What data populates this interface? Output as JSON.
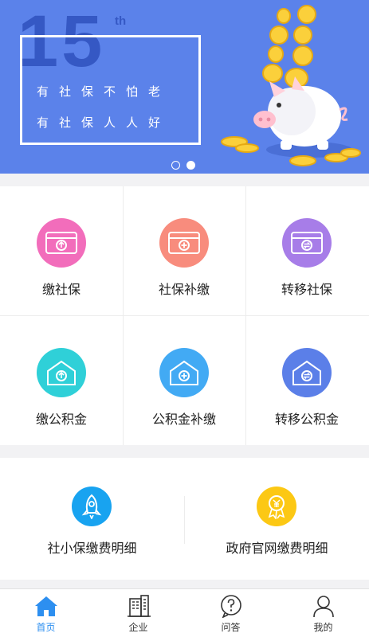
{
  "banner": {
    "big_number": "15",
    "superscript": "th",
    "slogan_line1": "有社保不怕老",
    "slogan_line2": "有社保人人好",
    "pager": {
      "count": 2,
      "active_index": 1
    }
  },
  "services": [
    {
      "label": "缴社保",
      "icon": "social-security-card-up-icon",
      "color": "#f26dbb"
    },
    {
      "label": "社保补缴",
      "icon": "social-security-card-plus-icon",
      "color": "#f88c7d"
    },
    {
      "label": "转移社保",
      "icon": "social-security-card-transfer-icon",
      "color": "#a77de8"
    },
    {
      "label": "缴公积金",
      "icon": "housing-fund-house-up-icon",
      "color": "#2fd0d8"
    },
    {
      "label": "公积金补缴",
      "icon": "housing-fund-house-plus-icon",
      "color": "#42aaf4"
    },
    {
      "label": "转移公积金",
      "icon": "housing-fund-house-transfer-icon",
      "color": "#5b7fe8"
    }
  ],
  "details": [
    {
      "label": "社小保缴费明细",
      "icon": "rocket-icon",
      "color": "#18a3f0"
    },
    {
      "label": "政府官网缴费明细",
      "icon": "yuan-medal-icon",
      "color": "#fcc814"
    }
  ],
  "tabs": [
    {
      "label": "首页",
      "icon": "home-icon",
      "active": true
    },
    {
      "label": "企业",
      "icon": "building-icon",
      "active": false
    },
    {
      "label": "问答",
      "icon": "question-bubble-icon",
      "active": false
    },
    {
      "label": "我的",
      "icon": "user-icon",
      "active": false
    }
  ],
  "colors": {
    "banner_bg": "#5b82ea",
    "active_tab": "#2d8ff0"
  }
}
